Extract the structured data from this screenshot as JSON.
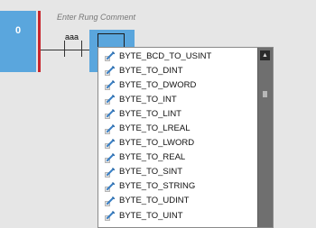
{
  "rung": {
    "number": "0",
    "comment_placeholder": "Enter Rung Comment",
    "contact_tag": "aaa"
  },
  "autocomplete": {
    "items": [
      {
        "label": "BYTE_BCD_TO_USINT",
        "icon": "instruction-icon"
      },
      {
        "label": "BYTE_TO_DINT",
        "icon": "instruction-icon"
      },
      {
        "label": "BYTE_TO_DWORD",
        "icon": "instruction-icon"
      },
      {
        "label": "BYTE_TO_INT",
        "icon": "instruction-icon"
      },
      {
        "label": "BYTE_TO_LINT",
        "icon": "instruction-icon"
      },
      {
        "label": "BYTE_TO_LREAL",
        "icon": "instruction-icon"
      },
      {
        "label": "BYTE_TO_LWORD",
        "icon": "instruction-icon"
      },
      {
        "label": "BYTE_TO_REAL",
        "icon": "instruction-icon"
      },
      {
        "label": "BYTE_TO_SINT",
        "icon": "instruction-icon"
      },
      {
        "label": "BYTE_TO_STRING",
        "icon": "instruction-icon"
      },
      {
        "label": "BYTE_TO_UDINT",
        "icon": "instruction-icon"
      },
      {
        "label": "BYTE_TO_UINT",
        "icon": "instruction-icon"
      }
    ],
    "scroll_up_icon": "chevron-up-icon"
  },
  "colors": {
    "selection_blue": "#5aa6dd",
    "rail_red": "#c8252c",
    "scrollbar": "#6f6f6f"
  }
}
